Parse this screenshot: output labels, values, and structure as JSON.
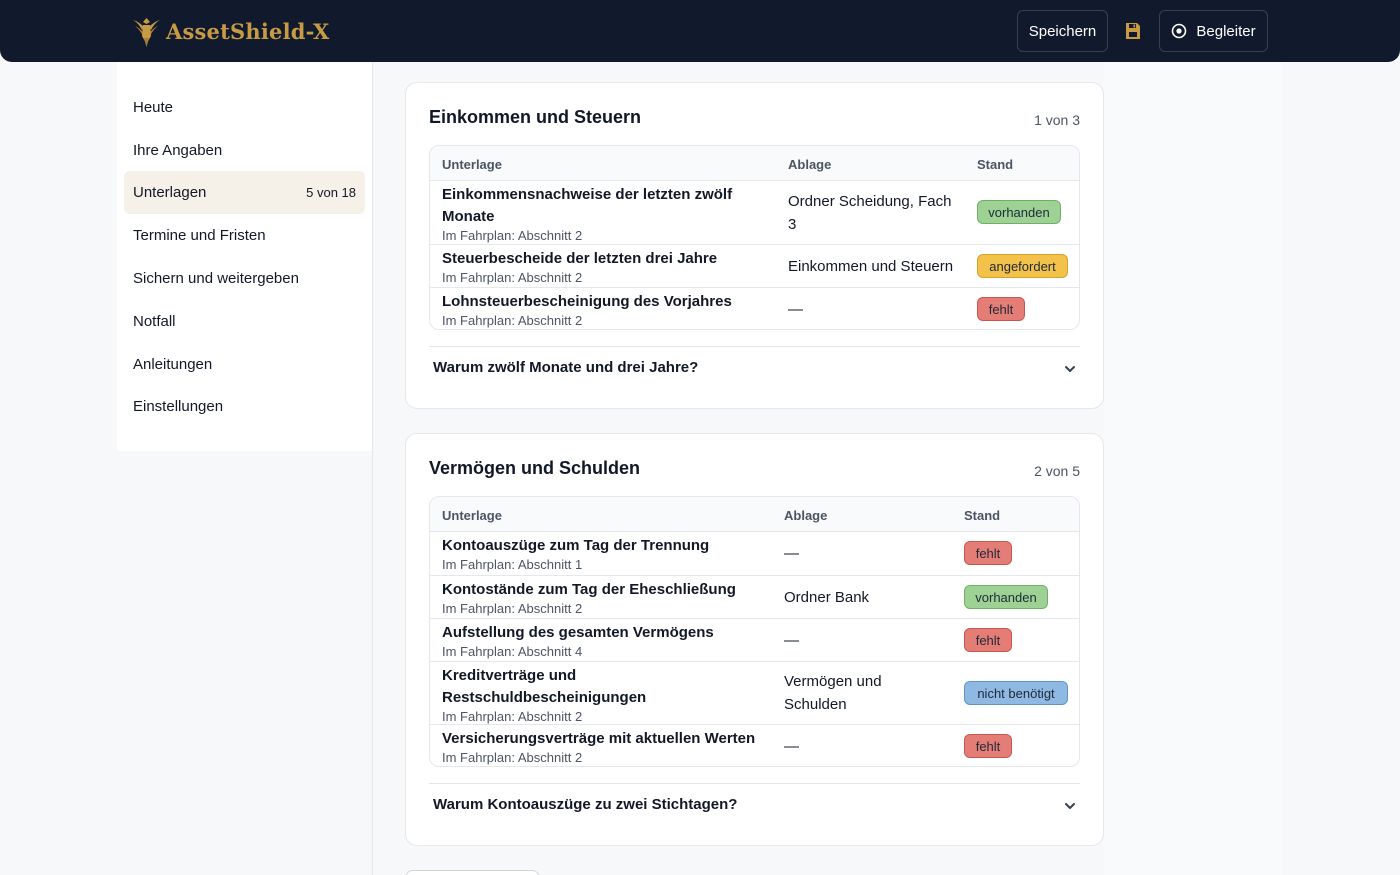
{
  "app": {
    "title": "AssetShield-X"
  },
  "header": {
    "save_label": "Speichern",
    "companion_label": "Begleiter",
    "icons": [
      "eagle-logo-icon",
      "floppy-disk-icon",
      "target-icon"
    ],
    "colors": {
      "bar": "#111a2d",
      "brand": "#c79a45"
    }
  },
  "sidebar": {
    "items": [
      {
        "label": "Heute"
      },
      {
        "label": "Ihre Angaben"
      },
      {
        "label": "Unterlagen",
        "count": "5 von 18",
        "active": true
      },
      {
        "label": "Termine und Fristen"
      },
      {
        "label": "Sichern und weitergeben"
      },
      {
        "label": "Notfall"
      },
      {
        "label": "Anleitungen"
      },
      {
        "label": "Einstellungen"
      }
    ]
  },
  "sections": [
    {
      "title": "Einkommen und Steuern",
      "count": "1 von 3",
      "columns": [
        "Unterlage",
        "Ablage",
        "Stand"
      ],
      "rows": [
        {
          "name": "Einkommensnachweise der letzten zwölf Monate",
          "sub": "Im Fahrplan: Abschnitt 2",
          "location": "Ordner Scheidung, Fach 3",
          "status": "vorhanden"
        },
        {
          "name": "Steuerbescheide der letzten drei Jahre",
          "sub": "Im Fahrplan: Abschnitt 2",
          "location": "Einkommen und Steuern",
          "status": "angefordert"
        },
        {
          "name": "Lohnsteuerbescheinigung des Vorjahres",
          "sub": "Im Fahrplan: Abschnitt 2",
          "location": "—",
          "status": "fehlt"
        }
      ],
      "faq": "Warum zwölf Monate und drei Jahre?"
    },
    {
      "title": "Vermögen und Schulden",
      "count": "2 von 5",
      "columns": [
        "Unterlage",
        "Ablage",
        "Stand"
      ],
      "rows": [
        {
          "name": "Kontoauszüge zum Tag der Trennung",
          "sub": "Im Fahrplan: Abschnitt 1",
          "location": "—",
          "status": "fehlt"
        },
        {
          "name": "Kontostände zum Tag der Eheschließung",
          "sub": "Im Fahrplan: Abschnitt 2",
          "location": "Ordner Bank",
          "status": "vorhanden"
        },
        {
          "name": "Aufstellung des gesamten Vermögens",
          "sub": "Im Fahrplan: Abschnitt 4",
          "location": "—",
          "status": "fehlt"
        },
        {
          "name": "Kreditverträge und Restschuldbescheinigungen",
          "sub": "Im Fahrplan: Abschnitt 2",
          "location": "Vermögen und Schulden",
          "status": "nicht benötigt"
        },
        {
          "name": "Versicherungsverträge mit aktuellen Werten",
          "sub": "Im Fahrplan: Abschnitt 2",
          "location": "—",
          "status": "fehlt"
        }
      ],
      "faq": "Warum Kontoauszüge zu zwei Stichtagen?"
    }
  ],
  "status_colors": {
    "vorhanden": "#9ed295",
    "angefordert": "#f2c24a",
    "fehlt": "#e57d77",
    "nicht benötigt": "#8fb8e3"
  }
}
